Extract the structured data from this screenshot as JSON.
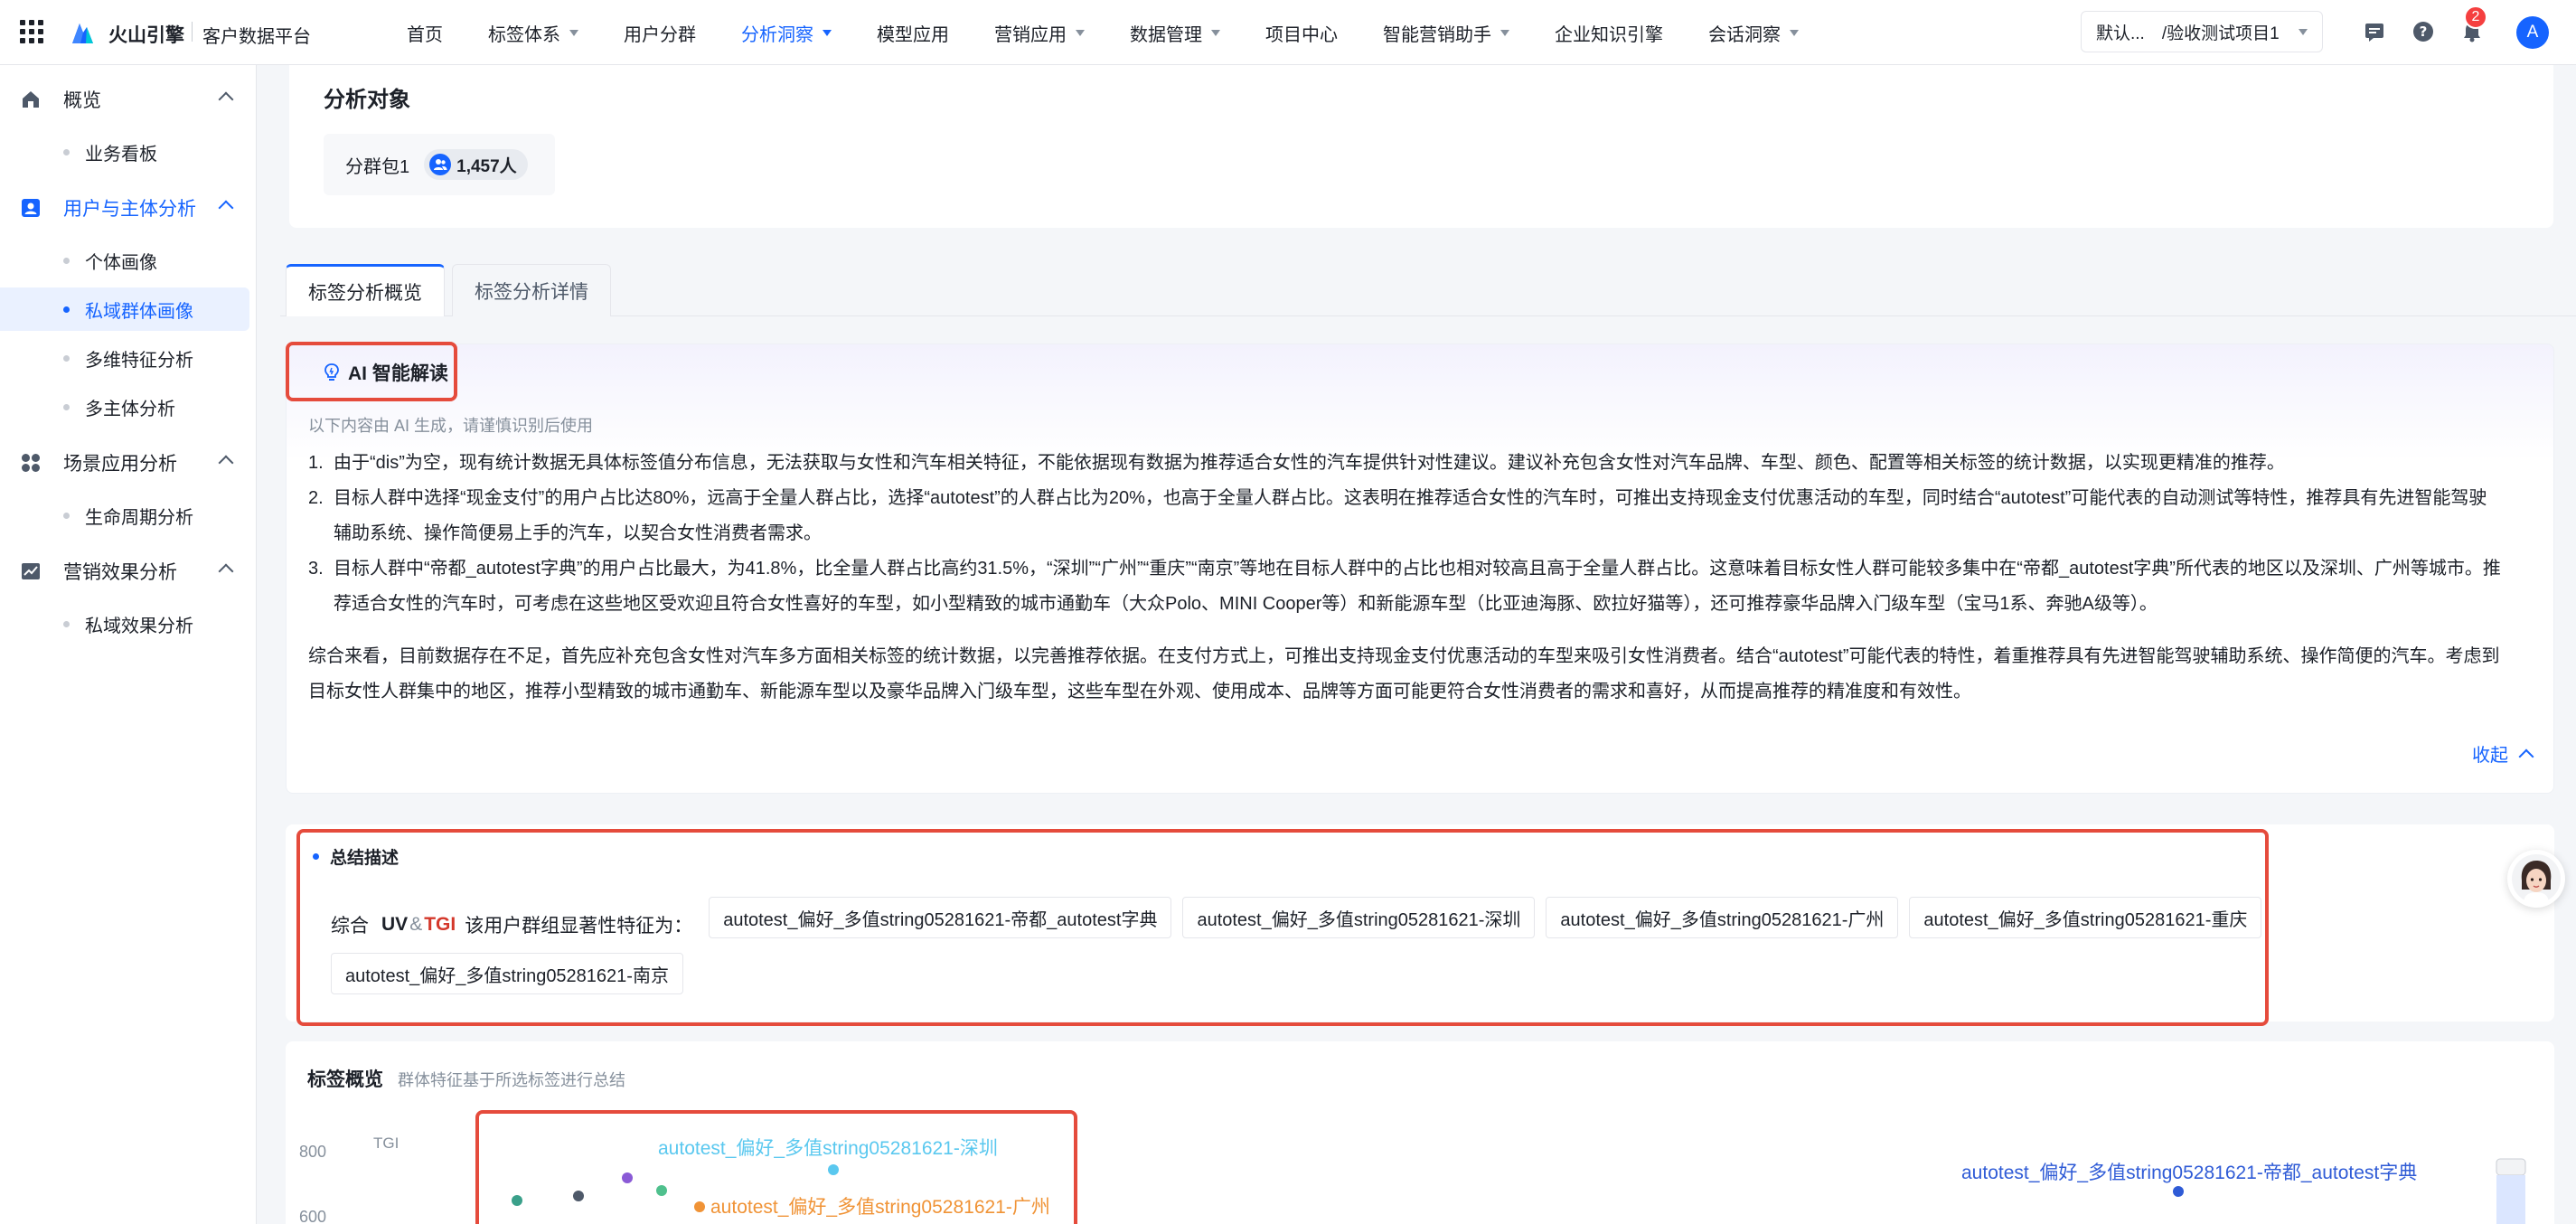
{
  "header": {
    "brand": "火山引擎",
    "platform": "客户数据平台",
    "nav": [
      {
        "label": "首页",
        "dropdown": false,
        "active": false
      },
      {
        "label": "标签体系",
        "dropdown": true,
        "active": false
      },
      {
        "label": "用户分群",
        "dropdown": false,
        "active": false
      },
      {
        "label": "分析洞察",
        "dropdown": true,
        "active": true
      },
      {
        "label": "模型应用",
        "dropdown": false,
        "active": false
      },
      {
        "label": "营销应用",
        "dropdown": true,
        "active": false
      },
      {
        "label": "数据管理",
        "dropdown": true,
        "active": false
      },
      {
        "label": "项目中心",
        "dropdown": false,
        "active": false
      },
      {
        "label": "智能营销助手",
        "dropdown": true,
        "active": false
      },
      {
        "label": "企业知识引擎",
        "dropdown": false,
        "active": false
      },
      {
        "label": "会话洞察",
        "dropdown": true,
        "active": false
      }
    ],
    "project_select": "默认...　/验收测试项目1",
    "notification_count": "2",
    "avatar_letter": "A",
    "accent_color": "#1664ff"
  },
  "sidebar": {
    "groups": [
      {
        "label": "概览",
        "icon": "home-icon",
        "active": false,
        "items": [
          {
            "label": "业务看板",
            "active": false
          }
        ]
      },
      {
        "label": "用户与主体分析",
        "icon": "user-card-icon",
        "active": true,
        "items": [
          {
            "label": "个体画像",
            "active": false
          },
          {
            "label": "私域群体画像",
            "active": true
          },
          {
            "label": "多维特征分析",
            "active": false
          },
          {
            "label": "多主体分析",
            "active": false
          }
        ]
      },
      {
        "label": "场景应用分析",
        "icon": "apps-circles-icon",
        "active": false,
        "items": [
          {
            "label": "生命周期分析",
            "active": false
          }
        ]
      },
      {
        "label": "营销效果分析",
        "icon": "trend-chart-icon",
        "active": false,
        "items": [
          {
            "label": "私域效果分析",
            "active": false
          }
        ]
      }
    ]
  },
  "analysis_object": {
    "title": "分析对象",
    "segment_name": "分群包1",
    "segment_count": "1,457人"
  },
  "tabs": [
    {
      "label": "标签分析概览",
      "active": true
    },
    {
      "label": "标签分析详情",
      "active": false
    }
  ],
  "ai_card": {
    "title": "AI 智能解读",
    "note": "以下内容由 AI 生成，请谨慎识别后使用",
    "items": [
      "由于“dis”为空，现有统计数据无具体标签值分布信息，无法获取与女性和汽车相关特征，不能依据现有数据为推荐适合女性的汽车提供针对性建议。建议补充包含女性对汽车品牌、车型、颜色、配置等相关标签的统计数据，以实现更精准的推荐。",
      "目标人群中选择“现金支付”的用户占比达80%，远高于全量人群占比，选择“autotest”的人群占比为20%，也高于全量人群占比。这表明在推荐适合女性的汽车时，可推出支持现金支付优惠活动的车型，同时结合“autotest”可能代表的自动测试等特性，推荐具有先进智能驾驶辅助系统、操作简便易上手的汽车，以契合女性消费者需求。",
      "目标人群中“帝都_autotest字典”的用户占比最大，为41.8%，比全量人群占比高约31.5%，“深圳”“广州”“重庆”“南京”等地在目标人群中的占比也相对较高且高于全量人群占比。这意味着目标女性人群可能较多集中在“帝都_autotest字典”所代表的地区以及深圳、广州等城市。推荐适合女性的汽车时，可考虑在这些地区受欢迎且符合女性喜好的车型，如小型精致的城市通勤车（大众Polo、MINI Cooper等）和新能源车型（比亚迪海豚、欧拉好猫等），还可推荐豪华品牌入门级车型（宝马1系、奔驰A级等）。"
    ],
    "summary": "综合来看，目前数据存在不足，首先应补充包含女性对汽车多方面相关标签的统计数据，以完善推荐依据。在支付方式上，可推出支持现金支付优惠活动的车型来吸引女性消费者。结合“autotest”可能代表的特性，着重推荐具有先进智能驾驶辅助系统、操作简便的汽车。考虑到目标女性人群集中的地区，推荐小型精致的城市通勤车、新能源车型以及豪华品牌入门级车型，这些车型在外观、使用成本、品牌等方面可能更符合女性消费者的需求和喜好，从而提高推荐的精准度和有效性。",
    "collapse_label": "收起"
  },
  "summary_card": {
    "title": "总结描述",
    "prefix": "综合",
    "uv": "UV",
    "amp": "&",
    "tgi": "TGI",
    "suffix": "该用户群组显著性特征为：",
    "tags": [
      "autotest_偏好_多值string05281621-帝都_autotest字典",
      "autotest_偏好_多值string05281621-深圳",
      "autotest_偏好_多值string05281621-广州",
      "autotest_偏好_多值string05281621-重庆",
      "autotest_偏好_多值string05281621-南京"
    ]
  },
  "tag_overview": {
    "title": "标签概览",
    "subtitle": "群体特征基于所选标签进行总结"
  },
  "chart_data": {
    "type": "scatter",
    "ylabel": "TGI",
    "y_ticks": [
      800,
      600
    ],
    "ylim": [
      600,
      800
    ],
    "labels": [
      {
        "text": "autotest_偏好_多值string05281621-深圳",
        "color": "#5ac8ef"
      },
      {
        "text": "autotest_偏好_多值string05281621-广州",
        "color": "#f09336"
      },
      {
        "text": "autotest_偏好_多值string05281621-帝都_autotest字典",
        "color": "#2f5bd6"
      }
    ],
    "points": [
      {
        "color": "#3aa08a"
      },
      {
        "color": "#4e5969"
      },
      {
        "color": "#8a5ad6"
      },
      {
        "color": "#4fc08d"
      },
      {
        "color": "#5ac8ef"
      },
      {
        "color": "#f09336"
      },
      {
        "color": "#2f5bd6"
      }
    ]
  }
}
